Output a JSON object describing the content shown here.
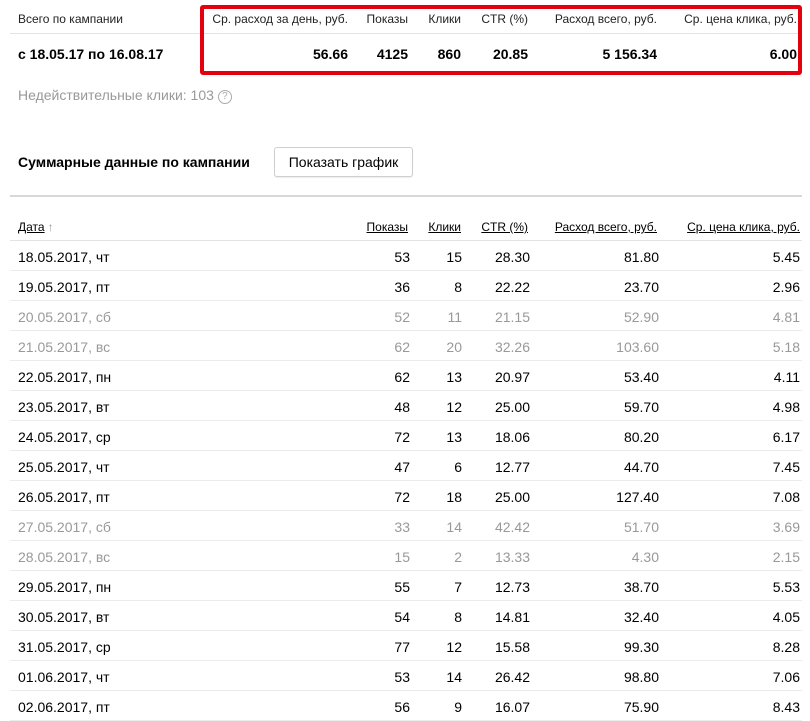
{
  "summary": {
    "label": "Всего по кампании",
    "period": "с 18.05.17 по 16.08.17",
    "headers": {
      "avg_daily": "Ср. расход за день, руб.",
      "impressions": "Показы",
      "clicks": "Клики",
      "ctr": "CTR (%)",
      "total": "Расход всего, руб.",
      "cpc": "Ср. цена клика, руб."
    },
    "values": {
      "avg_daily": "56.66",
      "impressions": "4125",
      "clicks": "860",
      "ctr": "20.85",
      "total": "5 156.34",
      "cpc": "6.00"
    },
    "highlight_color": "#e3000f"
  },
  "invalid_clicks": "Недействительные клики: 103",
  "help_icon": "question-circle-icon",
  "section_title": "Суммарные данные по кампании",
  "show_chart_button": "Показать график",
  "table": {
    "columns": {
      "date": "Дата",
      "sort_arrow": "↑",
      "impressions": "Показы",
      "clicks": "Клики",
      "ctr": "CTR (%)",
      "total": "Расход всего, руб.",
      "cpc": "Ср. цена клика, руб."
    },
    "rows": [
      {
        "date": "18.05.2017, чт",
        "impressions": "53",
        "clicks": "15",
        "ctr": "28.30",
        "total": "81.80",
        "cpc": "5.45",
        "weekend": false
      },
      {
        "date": "19.05.2017, пт",
        "impressions": "36",
        "clicks": "8",
        "ctr": "22.22",
        "total": "23.70",
        "cpc": "2.96",
        "weekend": false
      },
      {
        "date": "20.05.2017, сб",
        "impressions": "52",
        "clicks": "11",
        "ctr": "21.15",
        "total": "52.90",
        "cpc": "4.81",
        "weekend": true
      },
      {
        "date": "21.05.2017, вс",
        "impressions": "62",
        "clicks": "20",
        "ctr": "32.26",
        "total": "103.60",
        "cpc": "5.18",
        "weekend": true
      },
      {
        "date": "22.05.2017, пн",
        "impressions": "62",
        "clicks": "13",
        "ctr": "20.97",
        "total": "53.40",
        "cpc": "4.11",
        "weekend": false
      },
      {
        "date": "23.05.2017, вт",
        "impressions": "48",
        "clicks": "12",
        "ctr": "25.00",
        "total": "59.70",
        "cpc": "4.98",
        "weekend": false
      },
      {
        "date": "24.05.2017, ср",
        "impressions": "72",
        "clicks": "13",
        "ctr": "18.06",
        "total": "80.20",
        "cpc": "6.17",
        "weekend": false
      },
      {
        "date": "25.05.2017, чт",
        "impressions": "47",
        "clicks": "6",
        "ctr": "12.77",
        "total": "44.70",
        "cpc": "7.45",
        "weekend": false
      },
      {
        "date": "26.05.2017, пт",
        "impressions": "72",
        "clicks": "18",
        "ctr": "25.00",
        "total": "127.40",
        "cpc": "7.08",
        "weekend": false
      },
      {
        "date": "27.05.2017, сб",
        "impressions": "33",
        "clicks": "14",
        "ctr": "42.42",
        "total": "51.70",
        "cpc": "3.69",
        "weekend": true
      },
      {
        "date": "28.05.2017, вс",
        "impressions": "15",
        "clicks": "2",
        "ctr": "13.33",
        "total": "4.30",
        "cpc": "2.15",
        "weekend": true
      },
      {
        "date": "29.05.2017, пн",
        "impressions": "55",
        "clicks": "7",
        "ctr": "12.73",
        "total": "38.70",
        "cpc": "5.53",
        "weekend": false
      },
      {
        "date": "30.05.2017, вт",
        "impressions": "54",
        "clicks": "8",
        "ctr": "14.81",
        "total": "32.40",
        "cpc": "4.05",
        "weekend": false
      },
      {
        "date": "31.05.2017, ср",
        "impressions": "77",
        "clicks": "12",
        "ctr": "15.58",
        "total": "99.30",
        "cpc": "8.28",
        "weekend": false
      },
      {
        "date": "01.06.2017, чт",
        "impressions": "53",
        "clicks": "14",
        "ctr": "26.42",
        "total": "98.80",
        "cpc": "7.06",
        "weekend": false
      },
      {
        "date": "02.06.2017, пт",
        "impressions": "56",
        "clicks": "9",
        "ctr": "16.07",
        "total": "75.90",
        "cpc": "8.43",
        "weekend": false
      }
    ]
  }
}
